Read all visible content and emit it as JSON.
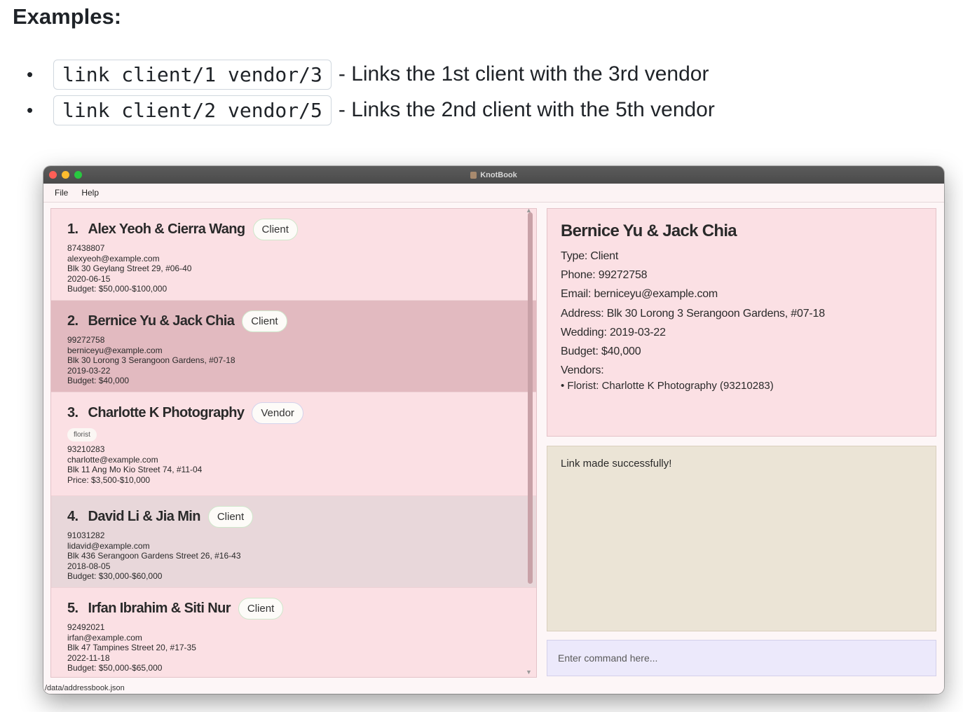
{
  "doc": {
    "heading": "Examples:",
    "examples": [
      {
        "code": "link client/1 vendor/3",
        "desc": "- Links the 1st client with the 3rd vendor"
      },
      {
        "code": "link client/2 vendor/5",
        "desc": "- Links the 2nd client with the 5th vendor"
      }
    ]
  },
  "window": {
    "title": "KnotBook",
    "menu": [
      "File",
      "Help"
    ]
  },
  "contacts": [
    {
      "index": "1.",
      "name": "Alex Yeoh & Cierra Wang",
      "type": "Client",
      "details": [
        "87438807",
        "alexyeoh@example.com",
        "Blk 30 Geylang Street 29, #06-40",
        "2020-06-15",
        "Budget: $50,000-$100,000"
      ]
    },
    {
      "index": "2.",
      "name": "Bernice Yu & Jack Chia",
      "type": "Client",
      "details": [
        "99272758",
        "berniceyu@example.com",
        "Blk 30 Lorong 3 Serangoon Gardens, #07-18",
        "2019-03-22",
        "Budget: $40,000"
      ]
    },
    {
      "index": "3.",
      "name": "Charlotte K Photography",
      "type": "Vendor",
      "tag": "florist",
      "details": [
        "93210283",
        "charlotte@example.com",
        "Blk 11 Ang Mo Kio Street 74, #11-04",
        "Price: $3,500-$10,000"
      ]
    },
    {
      "index": "4.",
      "name": "David Li & Jia Min",
      "type": "Client",
      "details": [
        "91031282",
        "lidavid@example.com",
        "Blk 436 Serangoon Gardens Street 26, #16-43",
        "2018-08-05",
        "Budget: $30,000-$60,000"
      ]
    },
    {
      "index": "5.",
      "name": "Irfan Ibrahim & Siti Nur",
      "type": "Client",
      "details": [
        "92492021",
        "irfan@example.com",
        "Blk 47 Tampines Street 20, #17-35",
        "2022-11-18",
        "Budget: $50,000-$65,000"
      ]
    }
  ],
  "detail": {
    "name": "Bernice Yu & Jack Chia",
    "type": "Type: Client",
    "phone": "Phone: 99272758",
    "email": "Email: berniceyu@example.com",
    "address": "Address: Blk 30 Lorong 3 Serangoon Gardens, #07-18",
    "wedding": "Wedding: 2019-03-22",
    "budget": "Budget: $40,000",
    "vendors_label": "Vendors:",
    "vendors": [
      "• Florist: Charlotte K Photography (93210283)"
    ]
  },
  "result": "Link made successfully!",
  "command": {
    "placeholder": "Enter command here..."
  },
  "status": "/data/addressbook.json",
  "colors": {
    "card_default": "#fbe0e4",
    "card_selected": "#e2bac0",
    "card_hover": "#e8d7da",
    "result_bg": "#ebe4d6",
    "command_bg": "#ece9fb"
  }
}
